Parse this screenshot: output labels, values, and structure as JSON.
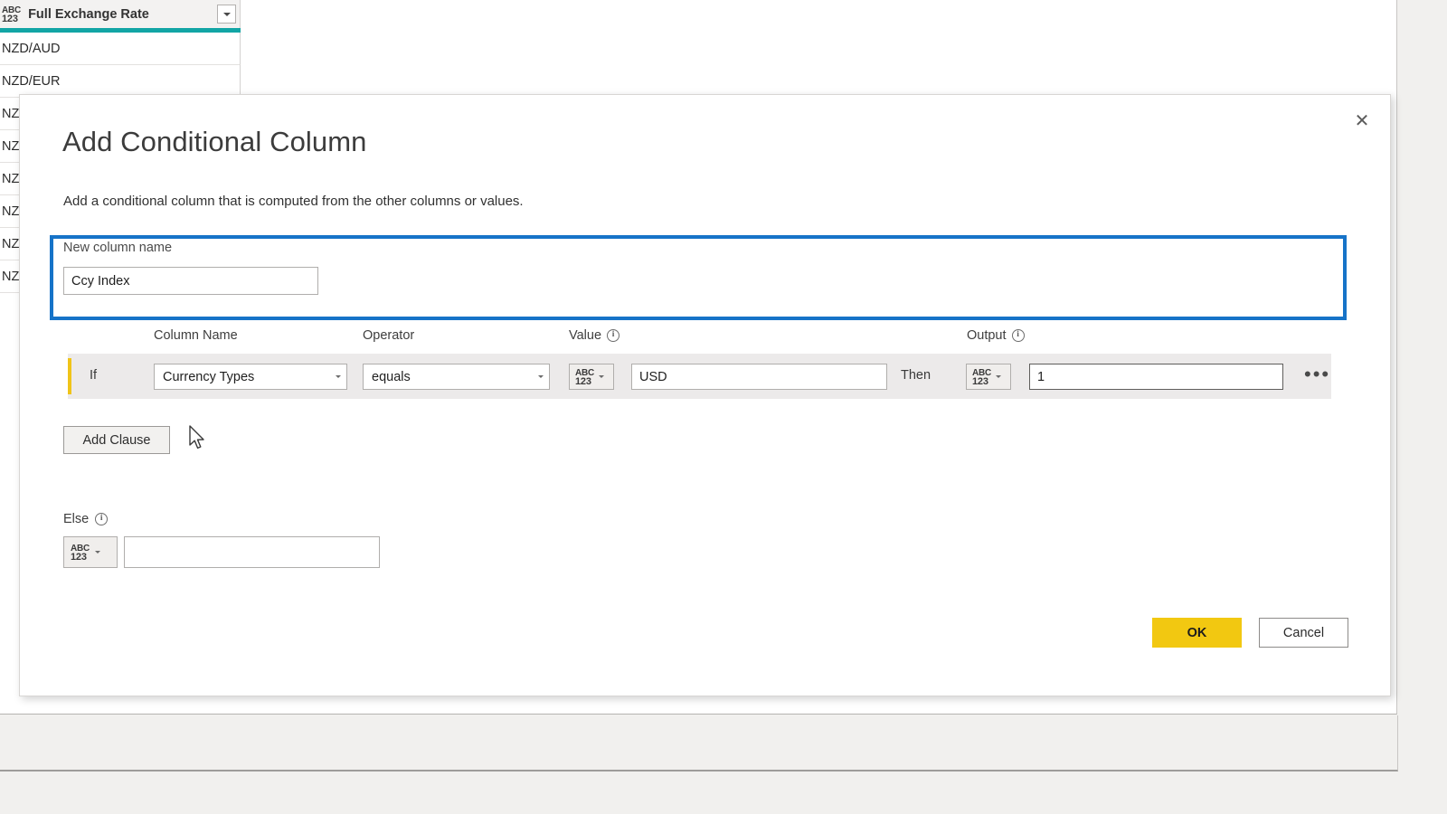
{
  "background": {
    "column": {
      "type_icon": "abc-123-text-type-icon",
      "type_icon_line1": "ABC",
      "type_icon_line2": "123",
      "header_title": "Full Exchange Rate",
      "dropdown_icon": "chevron-down-icon",
      "selected_accent_color": "#12a5a5"
    },
    "rows": [
      {
        "value": "NZD/AUD"
      },
      {
        "value": "NZD/EUR"
      },
      {
        "value": "NZ"
      },
      {
        "value": "NZ"
      },
      {
        "value": "NZ"
      },
      {
        "value": "NZ"
      },
      {
        "value": "NZ"
      },
      {
        "value": "NZ"
      }
    ]
  },
  "dialog": {
    "close_icon": "close-icon",
    "close_glyph": "✕",
    "title": "Add Conditional Column",
    "subtitle": "Add a conditional column that is computed from the other columns or values.",
    "highlight_color": "#1673c8",
    "new_column": {
      "label": "New column name",
      "value": "Ccy Index",
      "placeholder": ""
    },
    "clause_headers": {
      "column_name": "Column Name",
      "operator": "Operator",
      "value": "Value",
      "value_info_icon": "info-icon",
      "output": "Output",
      "output_info_icon": "info-icon",
      "info_glyph": "i"
    },
    "clause": {
      "accent_color": "#f0c419",
      "if_label": "If",
      "column_name": "Currency Types",
      "column_name_caret": "chevron-down-icon",
      "operator": "equals",
      "operator_caret": "chevron-down-icon",
      "value_type_line1": "ABC",
      "value_type_line2": "123",
      "value_type_caret": "chevron-down-icon",
      "value": "USD",
      "then_label": "Then",
      "output_type_line1": "ABC",
      "output_type_line2": "123",
      "output_type_caret": "chevron-down-icon",
      "output": "1",
      "more_glyph": "•••",
      "more_icon": "ellipsis-icon"
    },
    "add_clause_label": "Add Clause",
    "cursor_icon": "mouse-pointer-icon",
    "else": {
      "label": "Else",
      "info_icon": "info-icon",
      "info_glyph": "i",
      "type_line1": "ABC",
      "type_line2": "123",
      "type_caret": "chevron-down-icon",
      "value": "",
      "placeholder": ""
    },
    "footer": {
      "ok_label": "OK",
      "ok_color": "#f2c811",
      "cancel_label": "Cancel"
    }
  }
}
